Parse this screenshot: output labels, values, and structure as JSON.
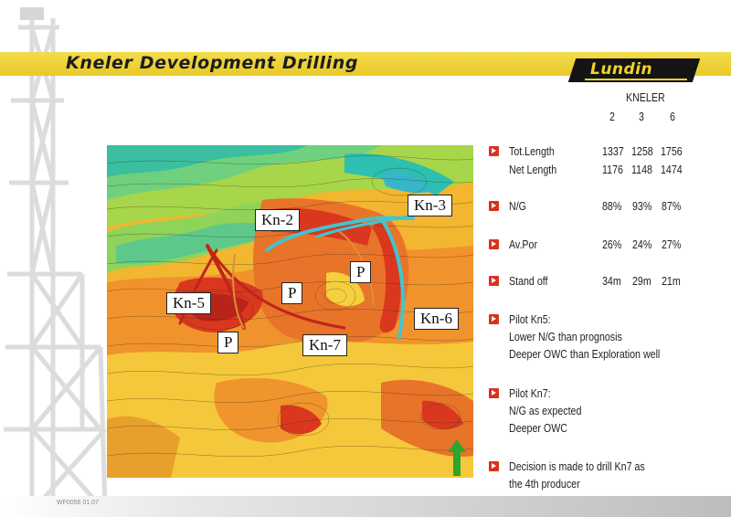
{
  "slide": {
    "title": "Kneler Development Drilling",
    "logo": "Lundin",
    "footer_code": "WF0056 01.07"
  },
  "map": {
    "labels": [
      "Kn-2",
      "Kn-3",
      "Kn-5",
      "Kn-6",
      "Kn-7",
      "P",
      "P",
      "P"
    ]
  },
  "table": {
    "group": "KNELER",
    "wells": [
      "2",
      "3",
      "6"
    ],
    "rows": [
      {
        "label": "Tot.Length",
        "values": [
          "1337",
          "1258",
          "1756"
        ]
      },
      {
        "label": "Net Length",
        "values": [
          "1176",
          "1148",
          "1474"
        ]
      },
      {
        "label": "N/G",
        "values": [
          "88%",
          "93%",
          "87%"
        ]
      },
      {
        "label": "Av.Por",
        "values": [
          "26%",
          "24%",
          "27%"
        ]
      },
      {
        "label": "Stand off",
        "values": [
          "34m",
          "29m",
          "21m"
        ]
      }
    ]
  },
  "notes": [
    {
      "lines": [
        "Pilot Kn5:",
        "Lower N/G than prognosis",
        "Deeper OWC than Exploration well"
      ]
    },
    {
      "lines": [
        "Pilot Kn7:",
        "N/G as expected",
        "Deeper OWC"
      ]
    },
    {
      "lines": [
        "Decision is made to drill Kn7 as",
        "the 4th producer"
      ]
    }
  ],
  "colors": {
    "accent": "#f2d32c",
    "bullet": "#d6331f",
    "logo_bg": "#141414"
  }
}
